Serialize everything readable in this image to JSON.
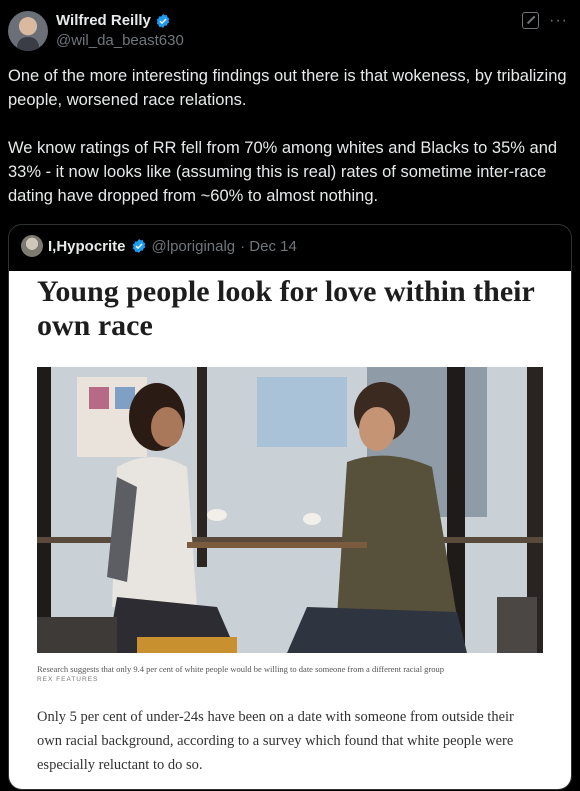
{
  "author": {
    "display_name": "Wilfred Reilly",
    "handle": "@wil_da_beast630",
    "verified": true
  },
  "header_icons": [
    "grok-icon",
    "more-icon"
  ],
  "more_label": "···",
  "tweet": {
    "text": "One of the more interesting findings out there is that wokeness, by tribalizing people, worsened race relations.\n\nWe know ratings of RR fell from 70% among whites and Blacks to 35% and 33% - it now looks like (assuming this is real) rates of sometime inter-race dating have dropped from ~60% to almost nothing."
  },
  "quoted": {
    "display_name": "I,Hypocrite",
    "handle": "@lporiginalg",
    "date": "· Dec 14",
    "verified": true,
    "article": {
      "headline": "Young people look for love within their own race",
      "caption": "Research suggests that only 9.4 per cent of white people would be willing to date someone from a different racial group",
      "credit": "REX FEATURES",
      "body": "Only 5 per cent of under-24s have been on a date with someone from outside their own racial background, according to a survey which found that white people were especially reluctant to do so."
    }
  },
  "colors": {
    "background": "#000000",
    "text": "#e7e9ea",
    "secondary": "#71767b",
    "verified": "#1d9bf0",
    "border": "#2f3336"
  }
}
